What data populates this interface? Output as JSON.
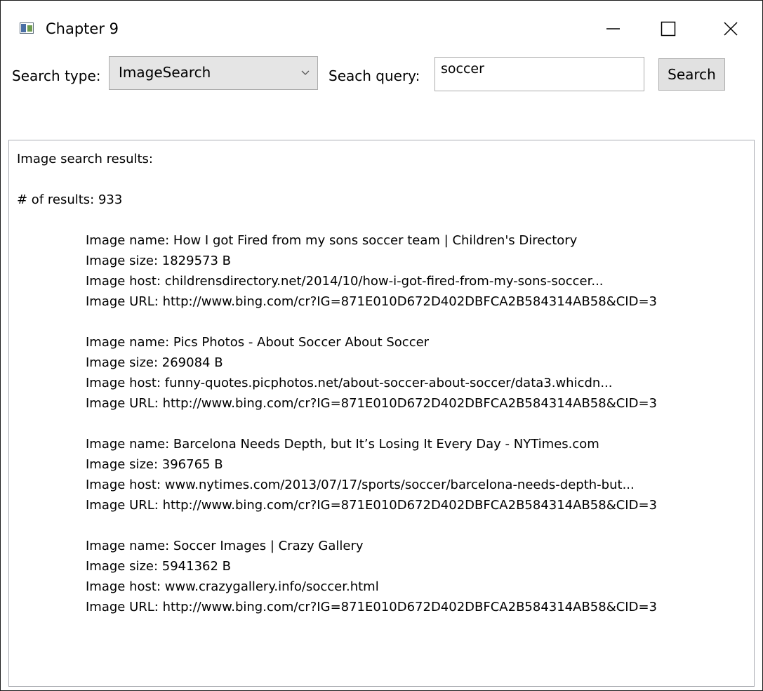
{
  "window": {
    "title": "Chapter 9",
    "controls": {
      "minimize_icon": "minimize-icon",
      "maximize_icon": "maximize-icon",
      "close_icon": "close-icon"
    }
  },
  "toolbar": {
    "search_type_label": "Search type:",
    "search_type_value": "ImageSearch",
    "search_query_label": "Seach query:",
    "search_query_value": "soccer",
    "search_button_label": "Search"
  },
  "results": {
    "heading": "Image search results:",
    "count_line": "# of results: 933",
    "items": [
      {
        "name": "Image name: How I got Fired from my sons soccer team | Children's Directory",
        "size": "Image size: 1829573 B",
        "host": "Image host: childrensdirectory.net/2014/10/how-i-got-fired-from-my-sons-soccer...",
        "url": "Image URL: http://www.bing.com/cr?IG=871E010D672D402DBFCA2B584314AB58&CID=3"
      },
      {
        "name": "Image name: Pics Photos - About Soccer About Soccer",
        "size": "Image size: 269084 B",
        "host": "Image host: funny-quotes.picphotos.net/about-soccer-about-soccer/data3.whicdn...",
        "url": "Image URL: http://www.bing.com/cr?IG=871E010D672D402DBFCA2B584314AB58&CID=3"
      },
      {
        "name": "Image name: Barcelona Needs Depth, but It’s Losing It Every Day - NYTimes.com",
        "size": "Image size: 396765 B",
        "host": "Image host: www.nytimes.com/2013/07/17/sports/soccer/barcelona-needs-depth-but...",
        "url": "Image URL: http://www.bing.com/cr?IG=871E010D672D402DBFCA2B584314AB58&CID=3"
      },
      {
        "name": "Image name: Soccer Images | Crazy Gallery",
        "size": "Image size: 5941362 B",
        "host": "Image host: www.crazygallery.info/soccer.html",
        "url": "Image URL: http://www.bing.com/cr?IG=871E010D672D402DBFCA2B584314AB58&CID=3"
      }
    ]
  }
}
